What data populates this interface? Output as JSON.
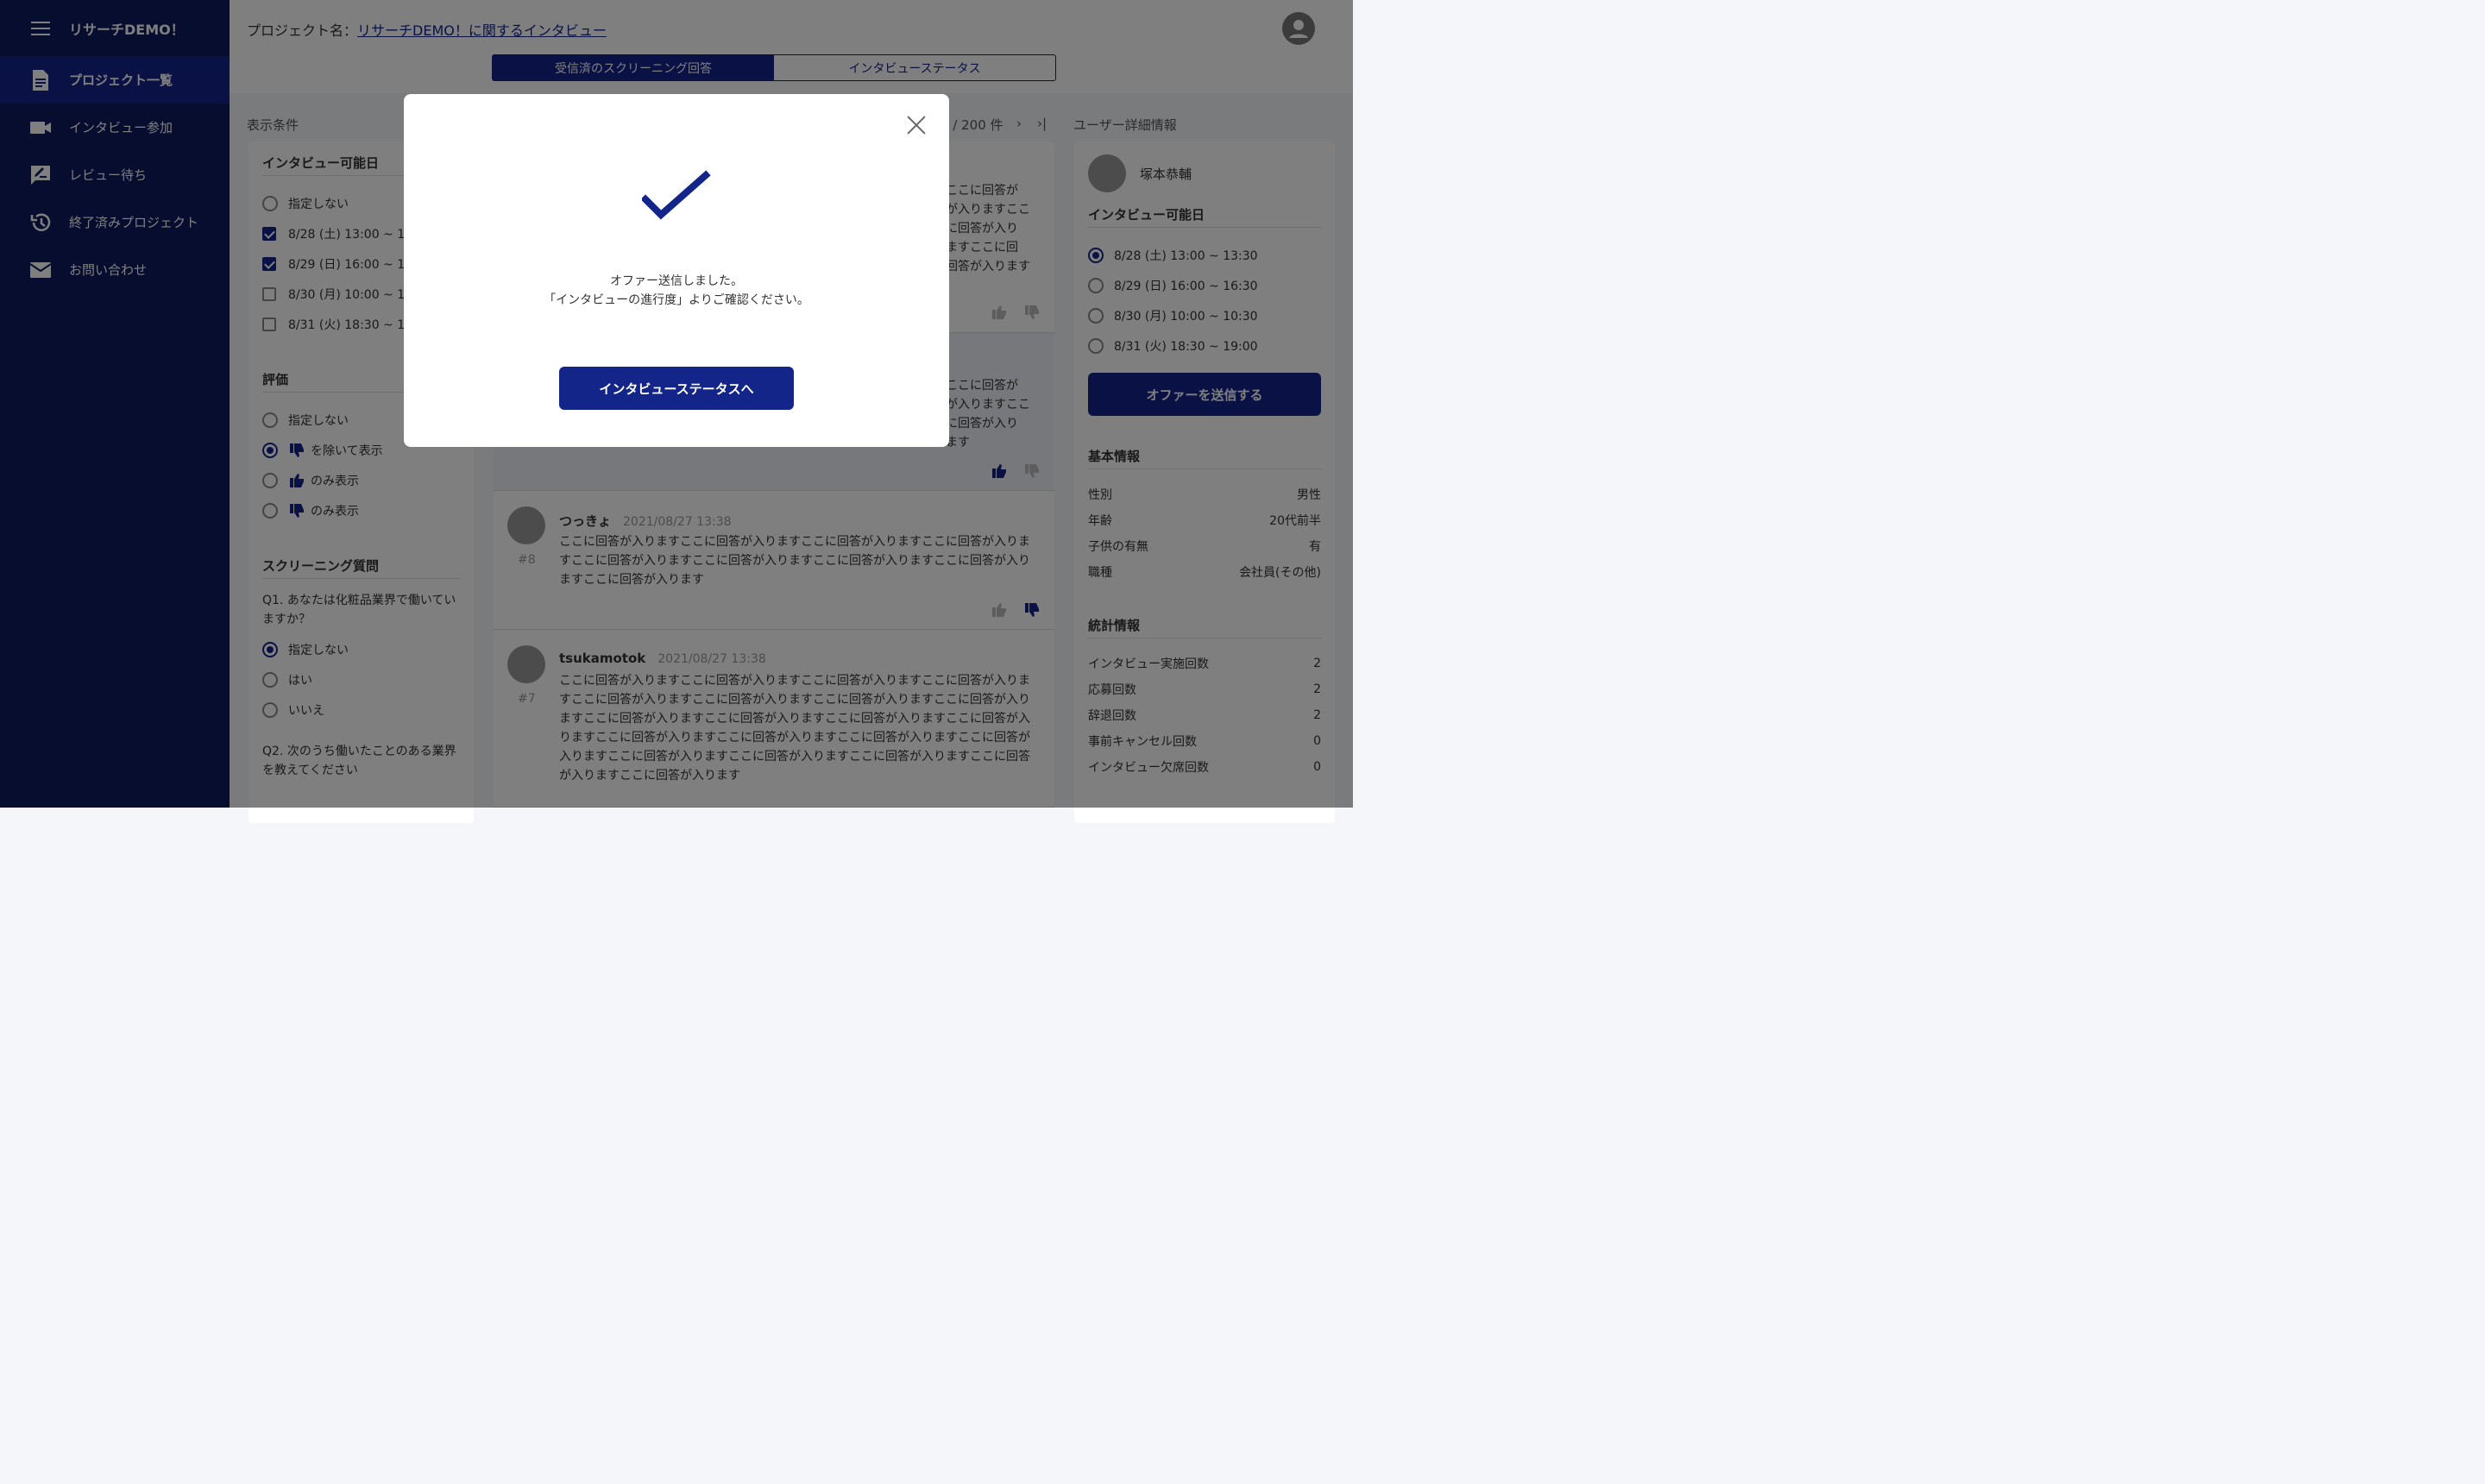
{
  "app": {
    "title": "リサーチDEMO！"
  },
  "sidebar": {
    "items": [
      {
        "label": "プロジェクト一覧",
        "icon": "document-icon"
      },
      {
        "label": "インタビュー参加",
        "icon": "video-icon"
      },
      {
        "label": "レビュー待ち",
        "icon": "review-icon"
      },
      {
        "label": "終了済みプロジェクト",
        "icon": "history-icon"
      },
      {
        "label": "お問い合わせ",
        "icon": "mail-icon"
      }
    ]
  },
  "header": {
    "project_prefix": "プロジェクト名：",
    "project_name": "リサーチDEMO！に関するインタビュー",
    "tabs": [
      {
        "label": "受信済のスクリーニング回答"
      },
      {
        "label": "インタビューステータス"
      }
    ]
  },
  "filters": {
    "section_label": "表示条件",
    "interview_date": {
      "title": "インタビュー可能日",
      "none_label": "指定しない",
      "options": [
        "8/28 (土) 13:00 ~ 13",
        "8/29 (日) 16:00 ~ 16",
        "8/30 (月) 10:00 ~ 10",
        "8/31 (火) 18:30 ~ 19"
      ]
    },
    "rating": {
      "title": "評価",
      "none_label": "指定しない",
      "exclude_label": "を除いて表示",
      "only_good_label": "のみ表示",
      "only_bad_label": "のみ表示"
    },
    "screening": {
      "title": "スクリーニング質問",
      "q1": "Q1. あなたは化粧品業界で働いていますか？",
      "q1_options": [
        "指定しない",
        "はい",
        "いいえ"
      ],
      "q2": "Q2. 次のうち働いたことのある業界を教えてください"
    }
  },
  "list": {
    "pager": "0 / 200 件",
    "partial_text_1": "ここに回答が\nが入りますここ\nに回答が入り\nますここに回\n回答が入ります",
    "partial_text_2": "ここに回答が\nが入りますここ\nに回答が入り\nます",
    "answers": [
      {
        "name": "つっきょ",
        "date": "2021/08/27 13:38",
        "num": "#8",
        "text": "ここに回答が入りますここに回答が入りますここに回答が入りますここに回答が入りますここに回答が入りますここに回答が入りますここに回答が入りますここに回答が入りますここに回答が入ります"
      },
      {
        "name": "tsukamotok",
        "date": "2021/08/27 13:38",
        "num": "#7",
        "text": "ここに回答が入りますここに回答が入りますここに回答が入りますここに回答が入りますここに回答が入りますここに回答が入りますここに回答が入りますここに回答が入りますここに回答が入りますここに回答が入りますここに回答が入りますここに回答が入りますここに回答が入りますここに回答が入りますここに回答が入りますここに回答が入りますここに回答が入りますここに回答が入りますここに回答が入りますここに回答が入りますここに回答が入ります"
      }
    ]
  },
  "detail": {
    "section_label": "ユーザー詳細情報",
    "user_name": "塚本恭輔",
    "dates_title": "インタビュー可能日",
    "dates": [
      "8/28 (土) 13:00 ~ 13:30",
      "8/29 (日) 16:00 ~ 16:30",
      "8/30 (月) 10:00 ~ 10:30",
      "8/31 (火) 18:30 ~ 19:00"
    ],
    "offer_button": "オファーを送信する",
    "basic_title": "基本情報",
    "basic": [
      {
        "k": "性別",
        "v": "男性"
      },
      {
        "k": "年齢",
        "v": "20代前半"
      },
      {
        "k": "子供の有無",
        "v": "有"
      },
      {
        "k": "職種",
        "v": "会社員(その他)"
      }
    ],
    "stats_title": "統計情報",
    "stats": [
      {
        "k": "インタビュー実施回数",
        "v": "2"
      },
      {
        "k": "応募回数",
        "v": "2"
      },
      {
        "k": "辞退回数",
        "v": "2"
      },
      {
        "k": "事前キャンセル回数",
        "v": "0"
      },
      {
        "k": "インタビュー欠席回数",
        "v": "0"
      }
    ]
  },
  "modal": {
    "line1": "オファー送信しました。",
    "line2": "「インタビューの進行度」よりご確認ください。",
    "button": "インタビューステータスへ"
  },
  "colors": {
    "primary": "#14258a",
    "sidebar": "#0d1a5c"
  }
}
